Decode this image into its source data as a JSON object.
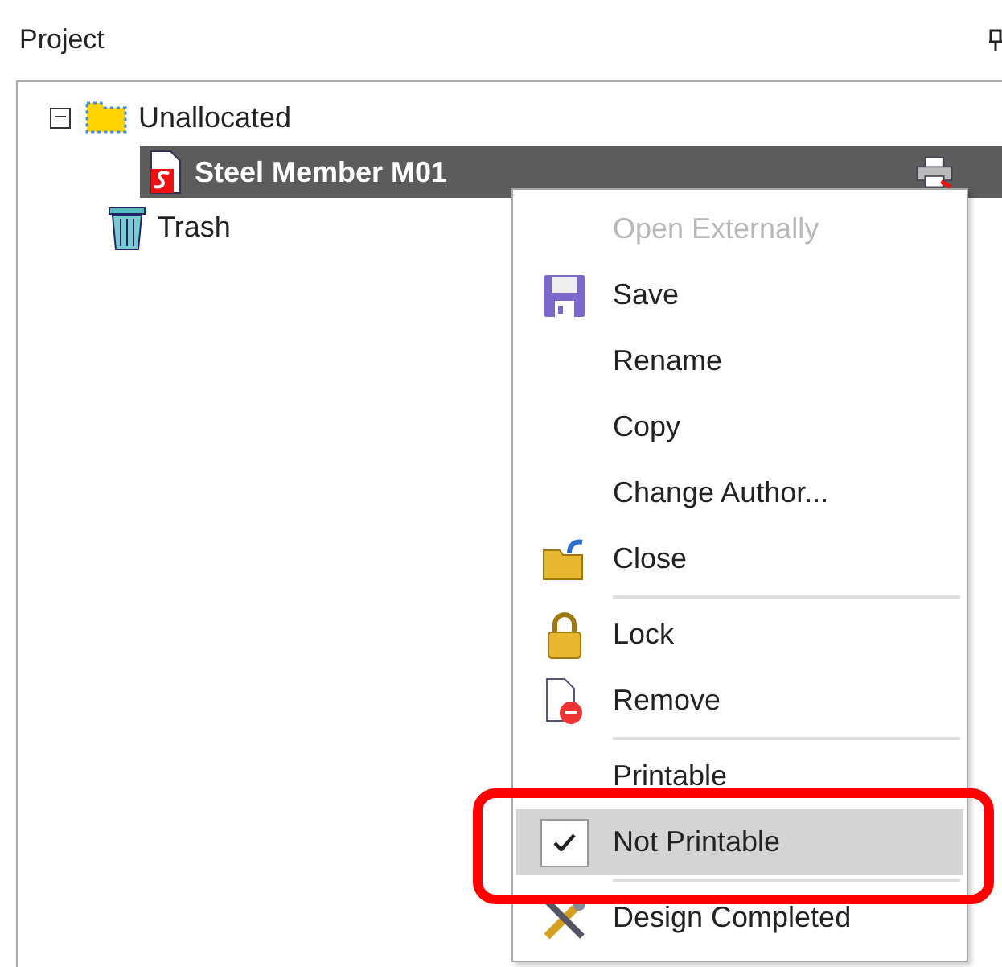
{
  "panel": {
    "title": "Project"
  },
  "tree": [
    {
      "label": "Unallocated",
      "expanded": true,
      "selected": false,
      "children": [
        {
          "label": "Steel Member M01",
          "selected": true
        }
      ]
    },
    {
      "label": "Trash",
      "selected": false
    }
  ],
  "context_menu": {
    "items": [
      {
        "kind": "item",
        "label": "Open Externally",
        "disabled": true,
        "checked": false,
        "selected": false
      },
      {
        "kind": "item",
        "label": "Save",
        "disabled": false,
        "checked": false,
        "selected": false
      },
      {
        "kind": "item",
        "label": "Rename",
        "disabled": false,
        "checked": false,
        "selected": false
      },
      {
        "kind": "item",
        "label": "Copy",
        "disabled": false,
        "checked": false,
        "selected": false
      },
      {
        "kind": "item",
        "label": "Change Author...",
        "disabled": false,
        "checked": false,
        "selected": false
      },
      {
        "kind": "item",
        "label": "Close",
        "disabled": false,
        "checked": false,
        "selected": false
      },
      {
        "kind": "separator"
      },
      {
        "kind": "item",
        "label": "Lock",
        "disabled": false,
        "checked": false,
        "selected": false
      },
      {
        "kind": "item",
        "label": "Remove",
        "disabled": false,
        "checked": false,
        "selected": false
      },
      {
        "kind": "separator"
      },
      {
        "kind": "item",
        "label": "Printable",
        "disabled": false,
        "checked": false,
        "selected": false
      },
      {
        "kind": "item",
        "label": "Not Printable",
        "disabled": false,
        "checked": true,
        "selected": true
      },
      {
        "kind": "separator"
      },
      {
        "kind": "item",
        "label": "Design Completed",
        "disabled": false,
        "checked": false,
        "selected": false
      }
    ]
  }
}
